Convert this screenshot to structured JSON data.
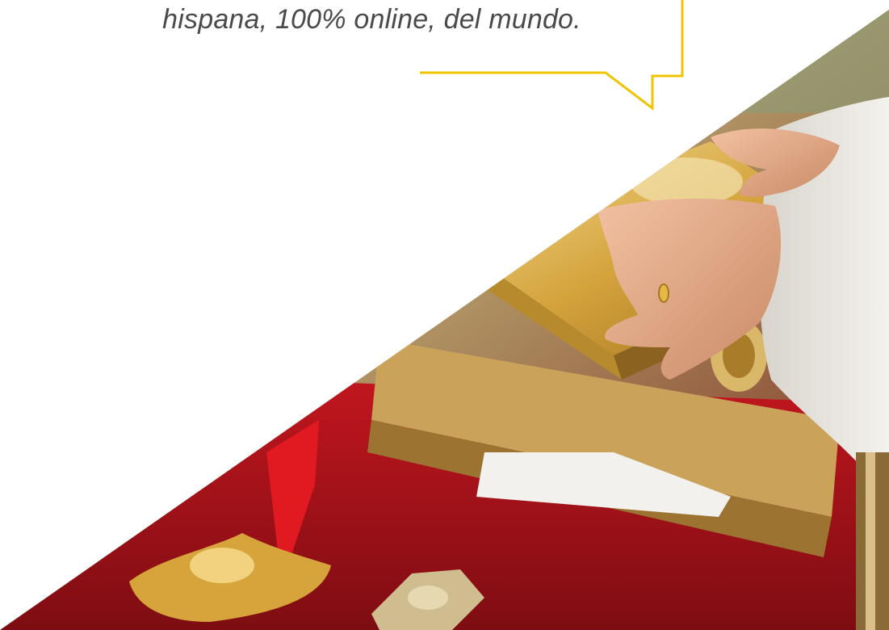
{
  "quote": {
    "text_line": "hispana, 100% online, del mundo."
  },
  "photo": {
    "subject": "ceremony-hands-on-golden-book",
    "colors": {
      "accent_yellow": "#f2c300",
      "gold": "#d9a441",
      "red_cloth": "#b8131b",
      "robe": "#e9e6e0",
      "skin": "#e9b08f"
    }
  }
}
